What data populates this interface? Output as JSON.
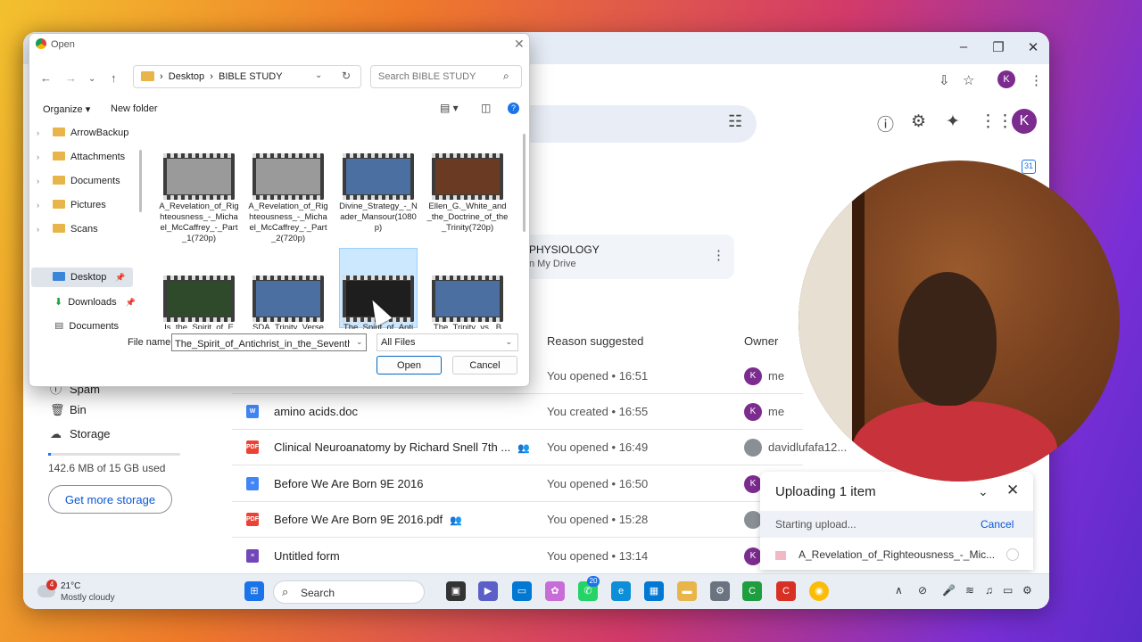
{
  "browser": {
    "avatar_letter": "K",
    "controls": {
      "minimize": "–",
      "maximize": "❐",
      "close": "✕"
    }
  },
  "drive": {
    "avatar_letter": "K",
    "suggested_card": {
      "title": "PHYSIOLOGY",
      "subtitle": "n My Drive"
    },
    "columns": {
      "reason": "Reason suggested",
      "owner": "Owner"
    },
    "rows": [
      {
        "name": "",
        "reason": "You opened • 16:51",
        "owner": "me",
        "owner_initial": "K",
        "icon": "",
        "icon_color": "#ffffff"
      },
      {
        "name": "amino acids.doc",
        "reason": "You created • 16:55",
        "owner": "me",
        "owner_initial": "K",
        "icon": "W",
        "icon_color": "#4285f4"
      },
      {
        "name": "Clinical Neuroanatomy by Richard Snell  7th ...",
        "reason": "You opened • 16:49",
        "owner": "davidlufafa12...",
        "owner_initial": "",
        "icon": "PDF",
        "icon_color": "#ea4335"
      },
      {
        "name": "Before We Are Born 9E 2016",
        "reason": "You opened • 16:50",
        "owner": "",
        "owner_initial": "K",
        "icon": "≡",
        "icon_color": "#4285f4"
      },
      {
        "name": "Before We Are Born 9E 2016.pdf",
        "reason": "You opened • 15:28",
        "owner": "",
        "owner_initial": "",
        "icon": "PDF",
        "icon_color": "#ea4335"
      },
      {
        "name": "Untitled form",
        "reason": "You opened • 13:14",
        "owner": "",
        "owner_initial": "K",
        "icon": "≡",
        "icon_color": "#7248b9"
      }
    ],
    "sidebar": {
      "spam": "Spam",
      "bin": "Bin",
      "storage": "Storage",
      "usage": "142.6 MB of 15 GB used",
      "usage_fraction": 0.0095,
      "get_more": "Get more storage"
    },
    "uploader": {
      "title": "Uploading 1 item",
      "status": "Starting upload...",
      "cancel": "Cancel",
      "file": "A_Revelation_of_Righteousness_-_Mic..."
    }
  },
  "dialog": {
    "title": "Open",
    "breadcrumb": [
      "Desktop",
      "BIBLE STUDY"
    ],
    "search_placeholder": "Search BIBLE STUDY",
    "organize": "Organize",
    "new_folder": "New folder",
    "tree": [
      {
        "label": "ArrowBackup"
      },
      {
        "label": "Attachments"
      },
      {
        "label": "Documents"
      },
      {
        "label": "Pictures"
      },
      {
        "label": "Scans"
      }
    ],
    "quick": [
      {
        "label": "Desktop"
      },
      {
        "label": "Downloads"
      },
      {
        "label": "Documents"
      }
    ],
    "files": [
      {
        "caption": "A_Revelation_of_Righteousness_-_Michael_McCaffrey_-_Part_1(720p)",
        "thumb_color": "#9a9a9a"
      },
      {
        "caption": "A_Revelation_of_Righteousness_-_Michael_McCaffrey_-_Part_2(720p)",
        "thumb_color": "#9a9a9a"
      },
      {
        "caption": "Divine_Strategy_-_Nader_Mansour(1080p)",
        "thumb_color": "#4a6fa0"
      },
      {
        "caption": "Ellen_G._White_and_the_Doctrine_of_the_Trinity(720p)",
        "thumb_color": "#6a3a22"
      },
      {
        "caption": "Is_the_Spirit_of_E",
        "thumb_color": "#2f4a2a"
      },
      {
        "caption": "SDA_Trinity_Verse",
        "thumb_color": "#4a6fa0"
      },
      {
        "caption": "The_Spirit_of_Anti",
        "thumb_color": "#1e1e1e"
      },
      {
        "caption": "The_Trinity_vs._B",
        "thumb_color": "#4a6fa0"
      }
    ],
    "filename_label": "File name:",
    "filename_value": "The_Spirit_of_Antichrist_in_the_Seventh-day_",
    "filter": "All Files",
    "open": "Open",
    "cancel": "Cancel"
  },
  "taskbar": {
    "temp": "21°C",
    "condition": "Mostly cloudy",
    "badge": "4",
    "search": "Search",
    "whatsapp_badge": "20"
  }
}
